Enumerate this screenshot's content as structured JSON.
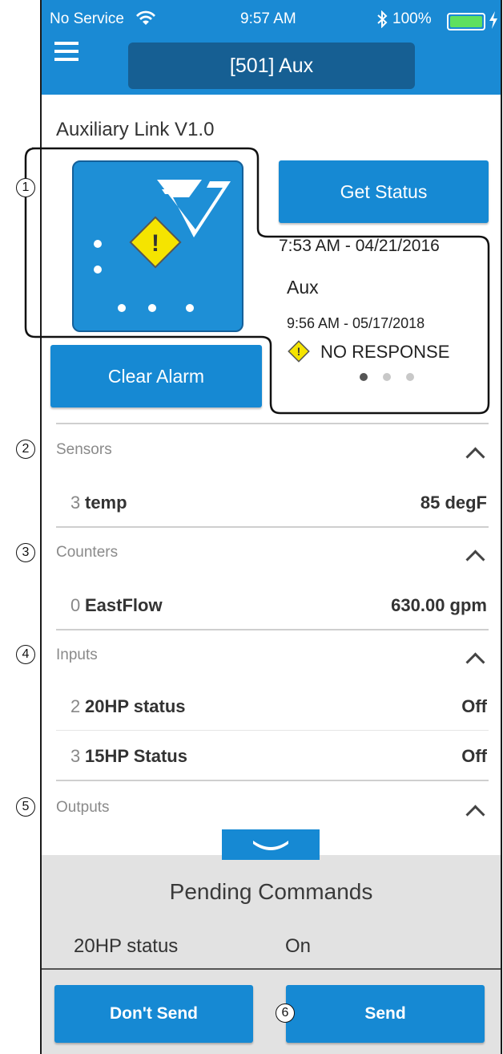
{
  "status_bar": {
    "carrier": "No Service",
    "time": "9:57 AM",
    "battery": "100%"
  },
  "header": {
    "title": "[501] Aux"
  },
  "device": {
    "name": "Auxiliary Link V1.0"
  },
  "actions": {
    "get_status": "Get Status",
    "clear_alarm": "Clear Alarm"
  },
  "status_time": "7:53 AM - 04/21/2016",
  "alarm_card": {
    "name": "Aux",
    "time": "9:56 AM - 05/17/2018",
    "message": "NO RESPONSE",
    "warning_glyph": "!"
  },
  "sections": {
    "sensors": {
      "title": "Sensors",
      "rows": [
        {
          "index": "3",
          "name": "temp",
          "value": "85 degF"
        }
      ]
    },
    "counters": {
      "title": "Counters",
      "rows": [
        {
          "index": "0",
          "name": "EastFlow",
          "value": "630.00 gpm"
        }
      ]
    },
    "inputs": {
      "title": "Inputs",
      "rows": [
        {
          "index": "2",
          "name": "20HP status",
          "value": "Off"
        },
        {
          "index": "3",
          "name": "15HP Status",
          "value": "Off"
        }
      ]
    },
    "outputs": {
      "title": "Outputs"
    }
  },
  "pending": {
    "title": "Pending Commands",
    "item_name": "20HP status",
    "item_value": "On",
    "dont_send": "Don't Send",
    "send": "Send"
  },
  "callouts": [
    "1",
    "2",
    "3",
    "4",
    "5",
    "6"
  ],
  "colors": {
    "brand_blue": "#1a8ad4",
    "header_title_box": "#165f93",
    "button_blue": "#1689d3",
    "warning_yellow": "#f5e400",
    "pending_panel": "#e2e2e2"
  },
  "icons": {
    "menu": "hamburger-icon",
    "wifi": "wifi-icon",
    "bluetooth": "bluetooth-icon",
    "battery": "battery-icon",
    "charging": "charging-bolt-icon",
    "logo": "rv-logo-icon",
    "warning": "warning-icon",
    "chevron_up": "chevron-up-icon",
    "chevron_down": "chevron-down-icon"
  }
}
